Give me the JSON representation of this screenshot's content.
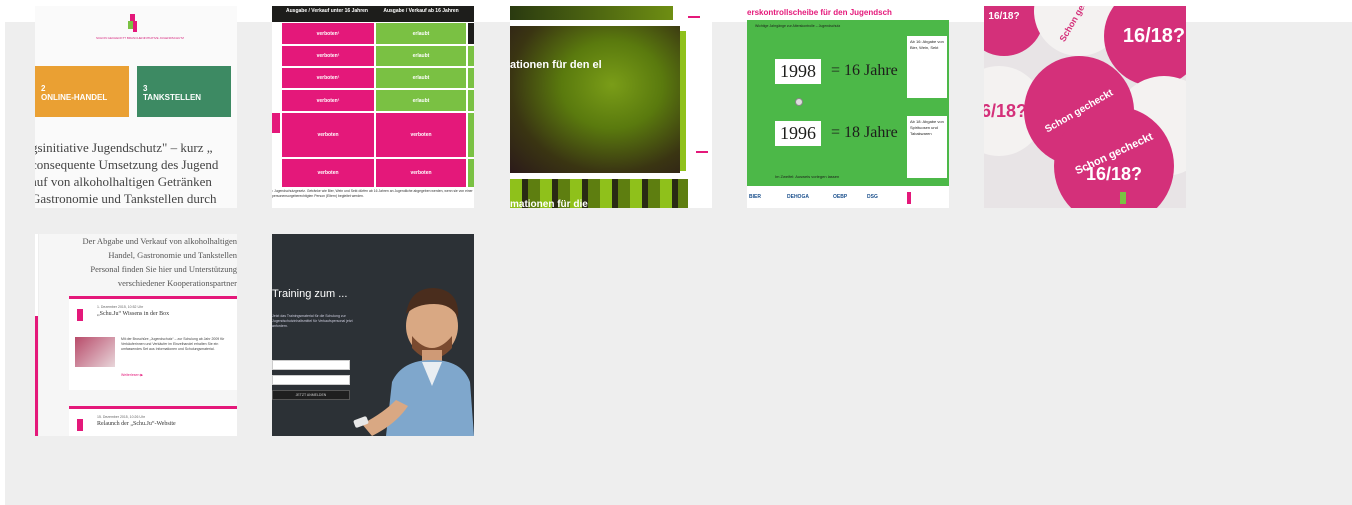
{
  "thumb1": {
    "logo_caption": "SCHON GECHECKT? BRANCHENINITIATIVE JUGENDSCHUTZ",
    "box1_num": "2",
    "box1_label": "ONLINE-HANDEL",
    "box2_num": "3",
    "box2_label": "TANKSTELLEN",
    "lines": [
      "gsinitiative Jugendschutz\" – kurz „",
      "consequente Umsetzung des Jugend",
      "auf von alkoholhaltigen Getränken",
      "Gastronomie und Tankstellen durch"
    ]
  },
  "thumb2": {
    "header_left": "Ausgabe / Verkauf unter 16 Jahren",
    "header_right": "Ausgabe / Verkauf ab 16 Jahren",
    "cell_forbidden": "verboten¹",
    "cell_allowed": "erlaubt",
    "cell_forbidden_plain": "verboten",
    "footnote": "¹ Jugendschutzgesetz. Getränke wie Bier, Wein und Sekt dürfen ab 16 Jahren an Jugendliche abgegeben werden, wenn sie von einer personensorgeberechtigten Person (Eltern) begleitet werden."
  },
  "thumb3": {
    "caption_top": "ationen für den el",
    "caption_bottom": "mationen für die"
  },
  "thumb4": {
    "title": "erskontrollscheibe für den Jugendsch",
    "instruction": "Wichtige Jahrgänge zur Alterskontrolle – Jugendschutz",
    "year1": "1998",
    "age1": "= 16 Jahre",
    "year2": "1996",
    "age2": "= 18 Jahre",
    "right_box1": "Ab 16: Abgabe von Bier, Wein, Sekt",
    "right_box2": "Ab 18: Abgabe von Spirituosen und Tabakwaren",
    "bottom": "Im Zweifel: Ausweis vorlegen lassen",
    "logos": [
      "BIER",
      "DEHOGA",
      "OEBP",
      "DSG"
    ]
  },
  "thumb5": {
    "badge_text": "Schon gecheckt",
    "badge_age": "16/18?"
  },
  "thumb6": {
    "intro_lines": [
      "Der Abgabe und Verkauf von alkoholhaltigen",
      "Handel, Gastronomie und Tankstellen",
      "Personal finden Sie hier und Unterstützung",
      "verschiedener Kooperationspartner"
    ],
    "card1_meta": "1. Dezember 2015, 10:52 Uhr",
    "card1_title": "„Schu.Ju“ Wissens in der Box",
    "card1_body": "Mit der Broschüre „Jugendschutz“ – zur Schulung ab Jahr 2009 für Verkäuferinnen und Verkäufer im Einzelhandel erhalten Sie ein umfassendes Set aus Informationen und Schulungsmaterial.",
    "card1_more": "Weiterlesen ▶",
    "card2_meta": "15. Dezember 2015, 10:26 Uhr",
    "card2_title": "Relaunch der „Schu.Ju“-Website"
  },
  "thumb7": {
    "heading": "Training zum ...",
    "sub": "Jetzt das Trainingsmaterial für die Schulung zur Jugendschutzinhaltsmittel für Verkaufspersonal jetzt anfordern.",
    "input1_placeholder": "",
    "input2_placeholder": "",
    "button_label": "JETZT ANMELDEN"
  }
}
